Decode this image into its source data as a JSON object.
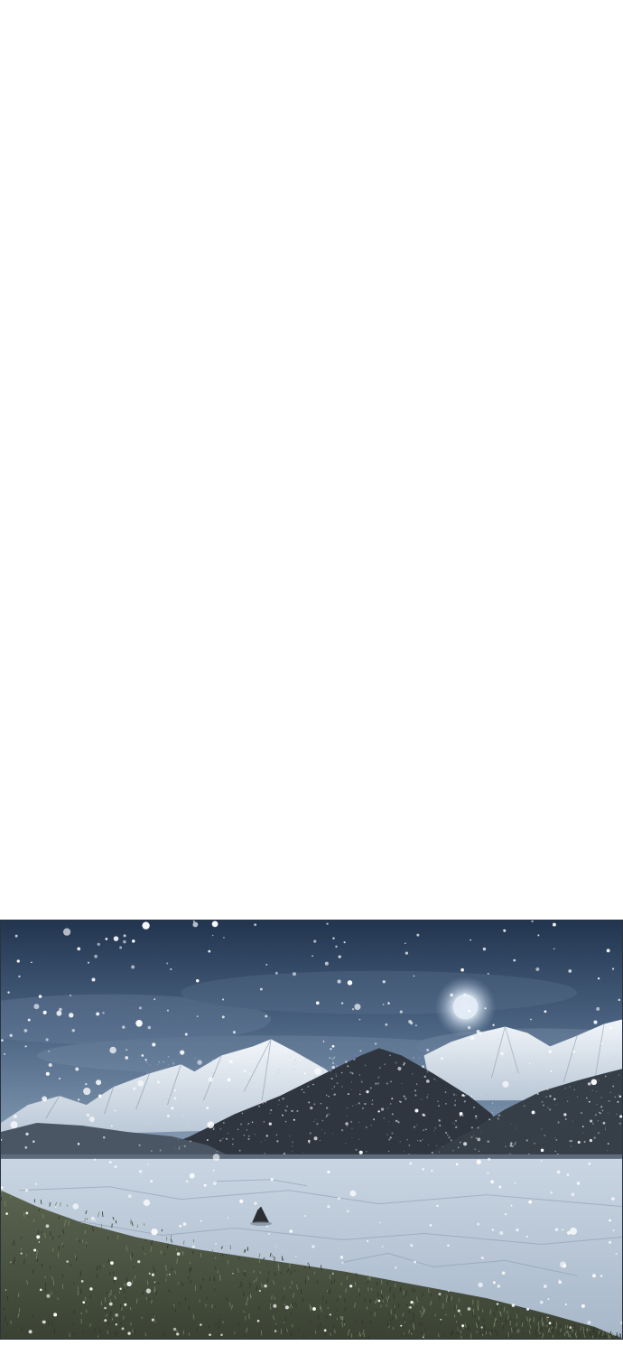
{
  "page": {
    "background": "#ffffff"
  },
  "panel": {
    "scene": "snowy-night-mountain-lake",
    "colors": {
      "sky_top": "#22354f",
      "sky_mid": "#4d6684",
      "sky_horizon": "#93a8bf",
      "moon": "#dfe9f4",
      "snow_peak": "#e8eef5",
      "rock_shadow": "#6d7f93",
      "dark_forest": "#2b323b",
      "ice": "#b8c6d6",
      "grass": "#4c5440"
    },
    "snow_seed": 42
  }
}
